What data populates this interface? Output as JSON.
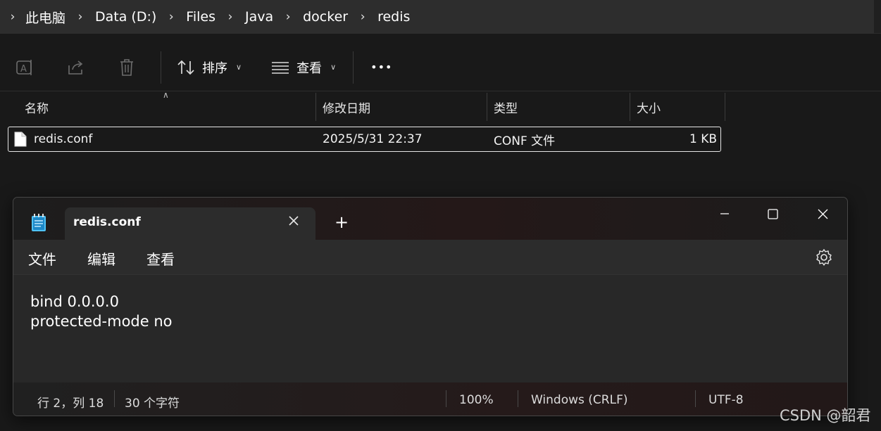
{
  "explorer": {
    "breadcrumb": [
      "此电脑",
      "Data (D:)",
      "Files",
      "Java",
      "docker",
      "redis"
    ],
    "toolbar": {
      "icons": [
        "rename-icon",
        "share-icon",
        "delete-icon"
      ],
      "sort_label": "排序",
      "view_label": "查看",
      "more_label": "•••"
    },
    "columns": [
      "名称",
      "修改日期",
      "类型",
      "大小"
    ],
    "files": [
      {
        "name": "redis.conf",
        "modified": "2025/5/31 22:37",
        "type": "CONF 文件",
        "size": "1 KB"
      }
    ]
  },
  "notepad": {
    "tab_title": "redis.conf",
    "new_tab_label": "+",
    "menu": [
      "文件",
      "编辑",
      "查看"
    ],
    "content_lines": [
      "bind 0.0.0.0",
      "protected-mode no"
    ],
    "status": {
      "position": "行 2，列 18",
      "chars": "30 个字符",
      "zoom": "100%",
      "line_ending": "Windows (CRLF)",
      "encoding": "UTF-8"
    }
  },
  "watermark": "CSDN @韶君",
  "colors": {
    "explorer_bg": "#191919",
    "address_bar": "#2d2d2d",
    "notepad_bg": "#272727",
    "notepad_icon": "#4fc3f7"
  }
}
